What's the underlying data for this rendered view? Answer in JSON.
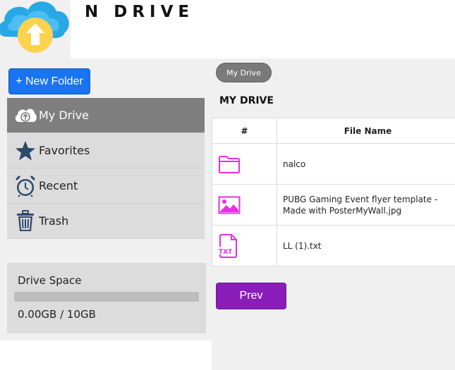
{
  "header": {
    "brand": "N DRIVE"
  },
  "toolbar": {
    "new_folder_label": "+ New Folder"
  },
  "sidebar": {
    "items": [
      {
        "label": "My Drive",
        "icon": "cloud-upload-icon",
        "active": true
      },
      {
        "label": "Favorites",
        "icon": "star-icon",
        "active": false
      },
      {
        "label": "Recent",
        "icon": "alarm-clock-icon",
        "active": false
      },
      {
        "label": "Trash",
        "icon": "trash-icon",
        "active": false
      }
    ]
  },
  "storage": {
    "title": "Drive Space",
    "usage_text": "0.00GB / 10GB",
    "used_fraction": 0
  },
  "breadcrumb": {
    "label": "My Drive"
  },
  "main": {
    "title": "MY DRIVE",
    "columns": [
      "#",
      "File Name"
    ],
    "files": [
      {
        "icon": "folder-icon",
        "name": "nalco"
      },
      {
        "icon": "image-file-icon",
        "name": "PUBG Gaming Event flyer template - Made with PosterMyWall.jpg"
      },
      {
        "icon": "txt-file-icon",
        "name": "LL (1).txt"
      }
    ]
  },
  "pagination": {
    "prev_label": "Prev"
  },
  "colors": {
    "accent_blue": "#1a73f0",
    "file_icon": "#e62ee6",
    "prev_button": "#8a1db8",
    "active_nav": "#7f7f7f"
  }
}
